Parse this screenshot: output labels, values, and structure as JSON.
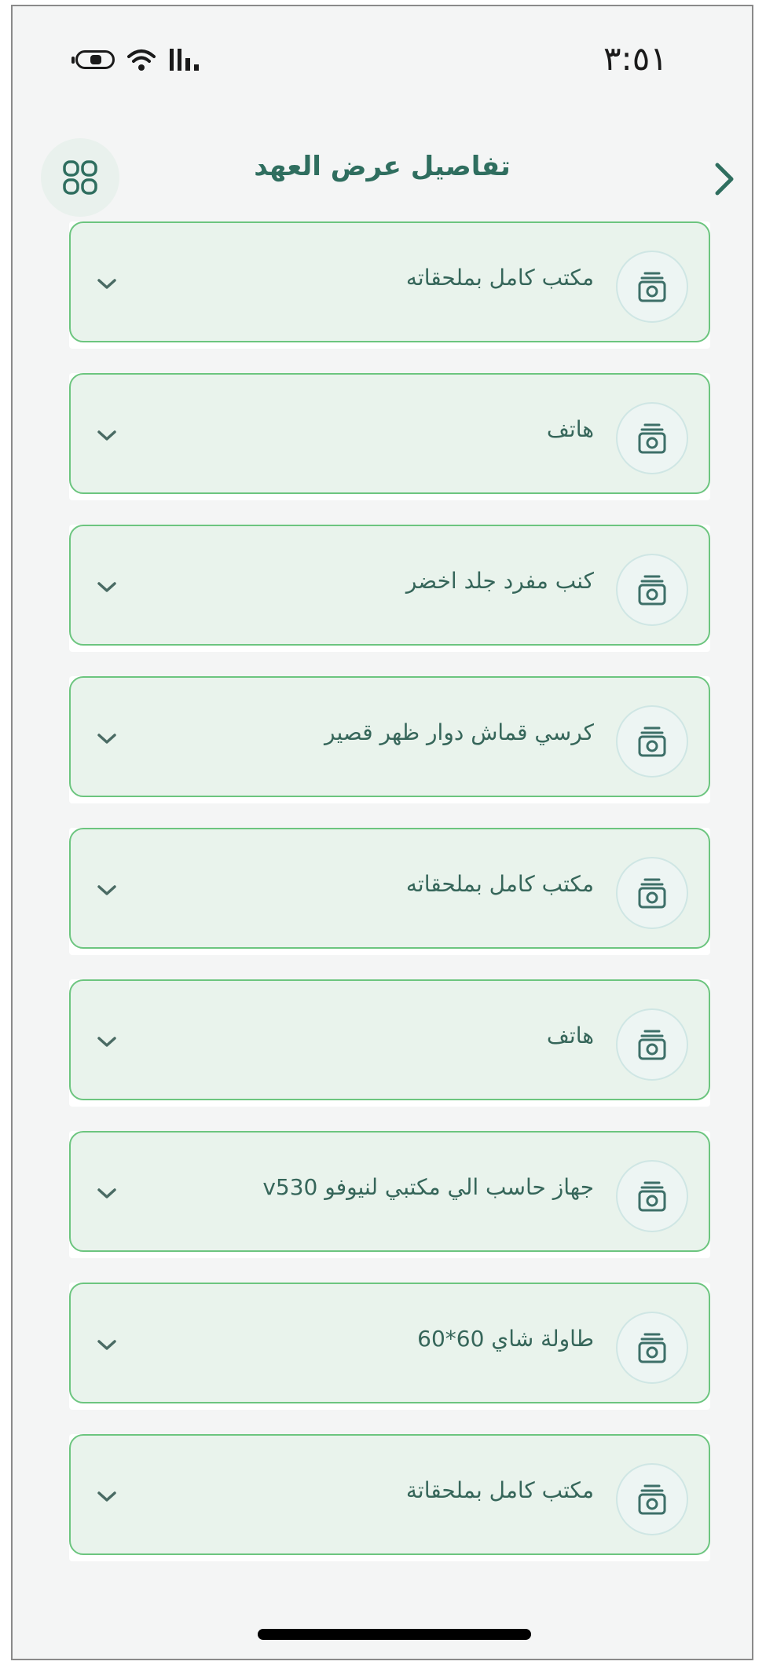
{
  "status_bar": {
    "time": "٣:٥١",
    "icons": [
      "battery-icon",
      "wifi-icon",
      "signal-icon"
    ]
  },
  "header": {
    "title": "تفاصيل عرض العهد",
    "menu_icon": "grid-icon",
    "back_icon": "chevron-right-icon"
  },
  "colors": {
    "accent": "#2f6e5f",
    "card_bg": "#e9f3ec",
    "card_border": "#6cc57f",
    "page_bg": "#f4f5f5"
  },
  "items": [
    {
      "label": "مكتب كامل بملحقاته",
      "icon": "camera-icon"
    },
    {
      "label": "هاتف",
      "icon": "camera-icon"
    },
    {
      "label": "كنب مفرد جلد اخضر",
      "icon": "camera-icon"
    },
    {
      "label": "كرسي قماش دوار ظهر قصير",
      "icon": "camera-icon"
    },
    {
      "label": "مكتب كامل بملحقاته",
      "icon": "camera-icon"
    },
    {
      "label": "هاتف",
      "icon": "camera-icon"
    },
    {
      "label": "جهاز حاسب الي مكتبي لنيوفو v530",
      "icon": "camera-icon"
    },
    {
      "label": "طاولة شاي 60*60",
      "icon": "camera-icon"
    },
    {
      "label": "مكتب كامل بملحقاتة",
      "icon": "camera-icon"
    }
  ]
}
